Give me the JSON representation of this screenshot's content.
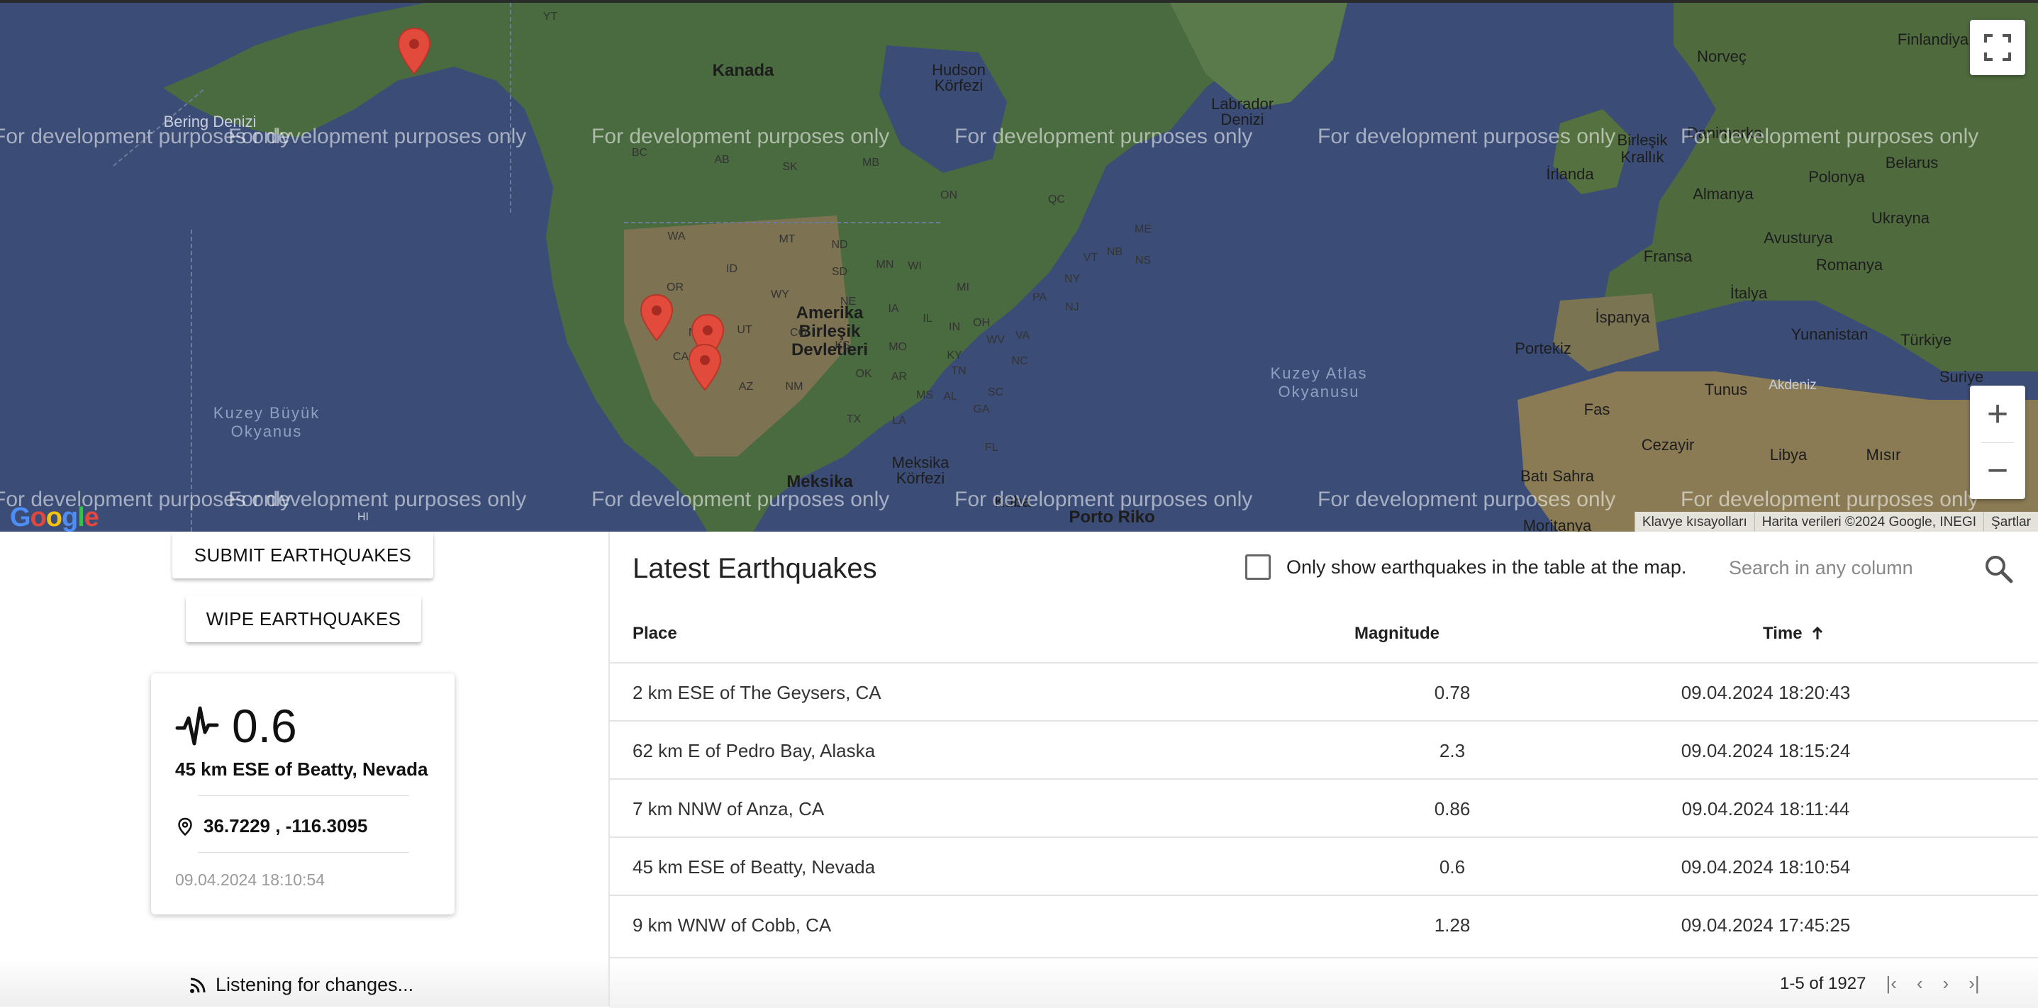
{
  "map": {
    "watermark": "For development purposes only",
    "labels_big": [
      {
        "text": "Kanada"
      },
      {
        "text": "Amerika\nBirleşik\nDevletleri"
      },
      {
        "text": "Meksika"
      },
      {
        "text": "Porto Riko"
      }
    ],
    "labels": [
      "Bering Denizi",
      "Hudson\nKörfezi",
      "Labrador\nDenizi",
      "Meksika\nKörfezi",
      "Norveç",
      "Finlandiya",
      "Birleşik\nKrallık",
      "İrlanda",
      "Danimarka",
      "Polonya",
      "Belarus",
      "Almanya",
      "Avusturya",
      "Ukrayna",
      "Fransa",
      "Romanya",
      "İtalya",
      "İspanya",
      "Portekiz",
      "Yunanistan",
      "Türkiye",
      "Tunus",
      "Akdeniz",
      "Suriye",
      "Fas",
      "Cezayir",
      "Libya",
      "Mısır",
      "Batı Sahra",
      "Moritanya",
      "Küba"
    ],
    "oceans": [
      "Kuzey Büyük\nOkyanus",
      "Kuzey Atlas\nOkyanusu"
    ],
    "states": [
      "YT",
      "BC",
      "AB",
      "SK",
      "MB",
      "ON",
      "QC",
      "NB",
      "NS",
      "WA",
      "OR",
      "ID",
      "MT",
      "ND",
      "MN",
      "SD",
      "WY",
      "NV",
      "CA",
      "UT",
      "CO",
      "NE",
      "IA",
      "IL",
      "WI",
      "MI",
      "IN",
      "OH",
      "PA",
      "NY",
      "VT",
      "ME",
      "NJ",
      "KS",
      "MO",
      "KY",
      "WV",
      "VA",
      "AZ",
      "NM",
      "OK",
      "AR",
      "TN",
      "NC",
      "SC",
      "MS",
      "AL",
      "GA",
      "TX",
      "LA",
      "FL",
      "HI"
    ],
    "google_logo": "Google",
    "footer": [
      "Klavye kısayolları",
      "Harita verileri ©2024 Google, INEGI",
      "Şartlar"
    ],
    "zoom_in": "+",
    "zoom_out": "−",
    "marker_color": "#e24b3b"
  },
  "buttons": {
    "submit": "SUBMIT EARTHQUAKES",
    "wipe": "WIPE EARTHQUAKES"
  },
  "card": {
    "magnitude": "0.6",
    "place": "45 km ESE of Beatty, Nevada",
    "coords": "36.7229 , -116.3095",
    "time": "09.04.2024 18:10:54",
    "icons": [
      "activity-icon",
      "location-pin-icon"
    ]
  },
  "status": {
    "listening": "Listening for changes..."
  },
  "table": {
    "title": "Latest Earthquakes",
    "filter_label": "Only show earthquakes in the table at the map.",
    "search_placeholder": "Search in any column",
    "columns": {
      "place": "Place",
      "magnitude": "Magnitude",
      "time": "Time"
    },
    "sort": {
      "column": "Time",
      "direction": "ascending"
    },
    "rows": [
      {
        "place": "2 km ESE of The Geysers, CA",
        "magnitude": "0.78",
        "time": "09.04.2024 18:20:43"
      },
      {
        "place": "62 km E of Pedro Bay, Alaska",
        "magnitude": "2.3",
        "time": "09.04.2024 18:15:24"
      },
      {
        "place": "7 km NNW of Anza, CA",
        "magnitude": "0.86",
        "time": "09.04.2024 18:11:44"
      },
      {
        "place": "45 km ESE of Beatty, Nevada",
        "magnitude": "0.6",
        "time": "09.04.2024 18:10:54"
      },
      {
        "place": "9 km WNW of Cobb, CA",
        "magnitude": "1.28",
        "time": "09.04.2024 17:45:25"
      }
    ],
    "pagination": "1-5 of 1927"
  },
  "colors": {
    "ocean": "#3b4d76",
    "land": "#4a6a3f",
    "desert": "#7d7352",
    "marker": "#e24b3b"
  }
}
